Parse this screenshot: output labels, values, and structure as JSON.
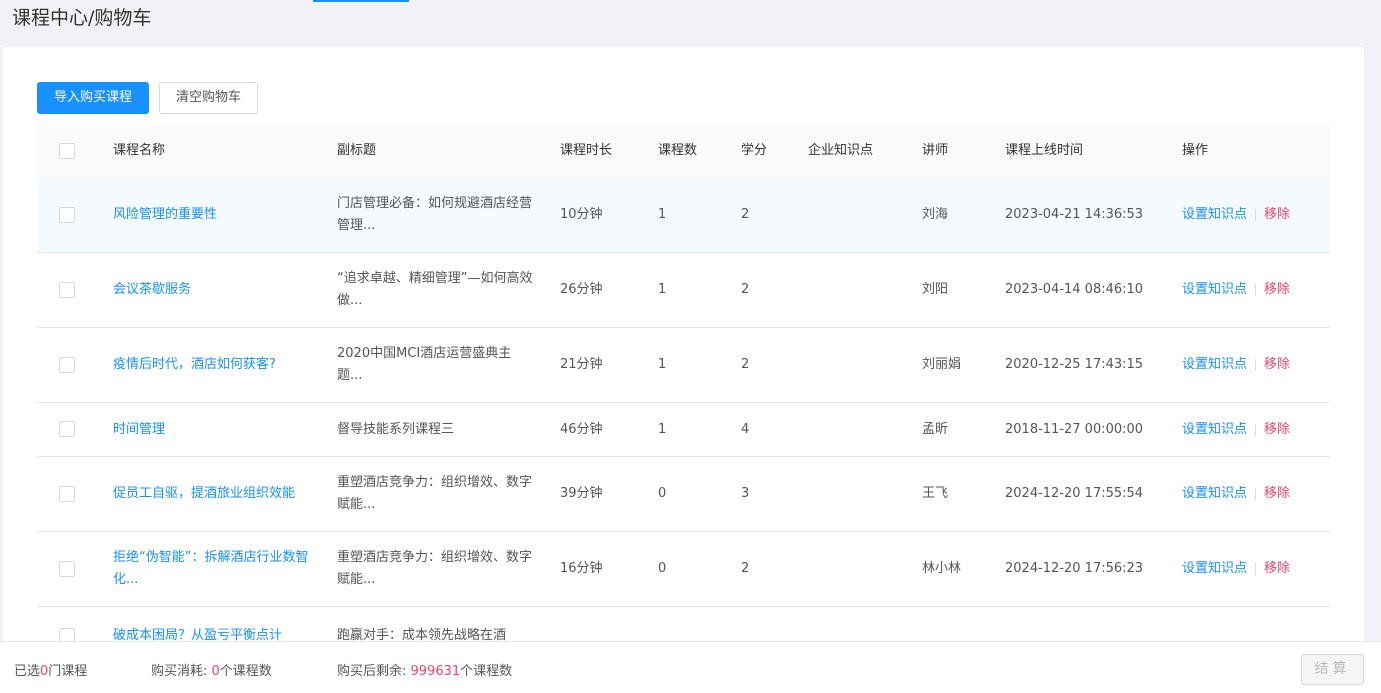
{
  "breadcrumb": "课程中心/购物车",
  "toolbar": {
    "import_label": "导入购买课程",
    "clear_label": "清空购物车"
  },
  "table": {
    "headers": {
      "name": "课程名称",
      "subtitle": "副标题",
      "duration": "课程时长",
      "count": "课程数",
      "credit": "学分",
      "knowledge": "企业知识点",
      "teacher": "讲师",
      "online_time": "课程上线时间",
      "ops": "操作"
    },
    "rows": [
      {
        "name": "风险管理的重要性",
        "subtitle": "门店管理必备：如何规避酒店经营管理...",
        "duration": "10分钟",
        "count": "1",
        "credit": "2",
        "knowledge": "",
        "teacher": "刘海",
        "online_time": "2023-04-21 14:36:53"
      },
      {
        "name": "会议茶歇服务",
        "subtitle": "“追求卓越、精细管理”—如何高效做...",
        "duration": "26分钟",
        "count": "1",
        "credit": "2",
        "knowledge": "",
        "teacher": "刘阳",
        "online_time": "2023-04-14 08:46:10"
      },
      {
        "name": "疫情后时代，酒店如何获客?",
        "subtitle": "2020中国MCI酒店运营盛典主题...",
        "duration": "21分钟",
        "count": "1",
        "credit": "2",
        "knowledge": "",
        "teacher": "刘丽娟",
        "online_time": "2020-12-25 17:43:15"
      },
      {
        "name": "时间管理",
        "subtitle": "督导技能系列课程三",
        "duration": "46分钟",
        "count": "1",
        "credit": "4",
        "knowledge": "",
        "teacher": "孟昕",
        "online_time": "2018-11-27 00:00:00"
      },
      {
        "name": "促员工自驱，提酒旅业组织效能",
        "subtitle": "重塑酒店竞争力：组织增效、数字赋能...",
        "duration": "39分钟",
        "count": "0",
        "credit": "3",
        "knowledge": "",
        "teacher": "王飞",
        "online_time": "2024-12-20 17:55:54"
      },
      {
        "name": "拒绝“伪智能”：拆解酒店行业数智化...",
        "subtitle": "重塑酒店竞争力：组织增效、数字赋能...",
        "duration": "16分钟",
        "count": "0",
        "credit": "2",
        "knowledge": "",
        "teacher": "林小林",
        "online_time": "2024-12-20 17:56:23"
      },
      {
        "name": "破成本困局？从盈亏平衡点计",
        "subtitle": "跑赢对手：成本领先战略在酒",
        "duration": "",
        "count": "",
        "credit": "",
        "knowledge": "",
        "teacher": "",
        "online_time": ""
      }
    ],
    "op_set_label": "设置知识点",
    "op_remove_label": "移除"
  },
  "footer": {
    "selected_prefix": "已选",
    "selected_count": "0",
    "selected_suffix": "门课程",
    "consume_prefix": "购买消耗: ",
    "consume_count": "0",
    "consume_suffix": "个课程数",
    "remain_prefix": "购买后剩余: ",
    "remain_count": "999631",
    "remain_suffix": "个课程数",
    "settle_label": "结算"
  },
  "colors": {
    "primary": "#1890ff",
    "danger": "#f5426c"
  }
}
